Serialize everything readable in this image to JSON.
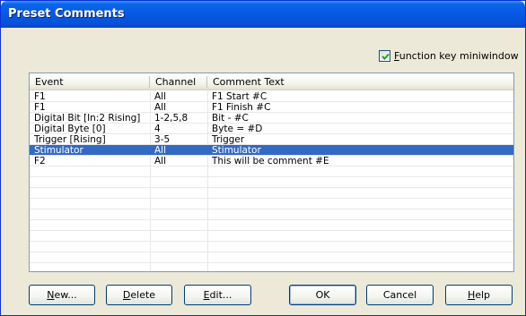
{
  "window": {
    "title": "Preset Comments"
  },
  "options": {
    "function_key_checked": true,
    "function_key_label_prefix": "F",
    "function_key_label_rest": "unction key miniwindow"
  },
  "list": {
    "columns": [
      "Event",
      "Channel",
      "Comment Text"
    ],
    "rows": [
      {
        "event": "F1",
        "channel": "All",
        "comment": "F1 Start #C",
        "selected": false
      },
      {
        "event": "F1",
        "channel": "All",
        "comment": "F1 Finish #C",
        "selected": false
      },
      {
        "event": "Digital Bit [In:2 Rising]",
        "channel": "1-2,5,8",
        "comment": "Bit - #C",
        "selected": false
      },
      {
        "event": "Digital Byte [0]",
        "channel": "4",
        "comment": "Byte = #D",
        "selected": false
      },
      {
        "event": "Trigger [Rising]",
        "channel": "3-5",
        "comment": "Trigger",
        "selected": false
      },
      {
        "event": "Stimulator",
        "channel": "All",
        "comment": "Stimulator",
        "selected": true
      },
      {
        "event": "F2",
        "channel": "All",
        "comment": "This will be comment #E",
        "selected": false
      }
    ]
  },
  "buttons": {
    "new": {
      "mnemonic": "N",
      "rest": "ew..."
    },
    "delete": {
      "mnemonic": "D",
      "rest": "elete"
    },
    "edit": {
      "mnemonic": "E",
      "rest": "dit..."
    },
    "ok": {
      "label": "OK"
    },
    "cancel": {
      "label": "Cancel"
    },
    "help": {
      "mnemonic": "H",
      "rest": "elp"
    }
  },
  "colors": {
    "title_bar": "#0858E0",
    "selection": "#316AC5",
    "dialog_bg": "#ECE9D8"
  }
}
